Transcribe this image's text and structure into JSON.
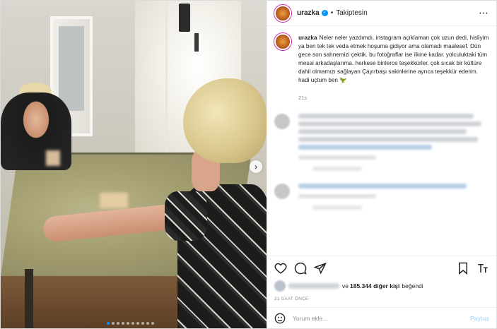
{
  "post": {
    "username": "urazka",
    "follow_status": "Takiptesin",
    "more_icon": "more-horizontal-icon"
  },
  "caption": {
    "username": "urazka",
    "text": "Neler neler yazdımdı. instagram açıklaman çok uzun dedi, hisliyim ya ben tek tek veda etmek hoşuma gidiyor ama olamadı maalesef. Dün gece son sahnemizi çektik. bu fotoğraflar ise ilkine kadar. yolculuktaki tüm mesai arkadaşlarıma. herkese binlerce teşekkürler. çok sıcak bir kültüre dahil olmamızı sağlayan Çayırbaşı sakinlerine ayrıca teşekkür ederim. hadi uçtum ben",
    "time": "21s"
  },
  "likes": {
    "suffix": "ve",
    "count": "185.344 diğer kişi",
    "end": "beğendi"
  },
  "posted_ago": "21 SAAT ÖNCE",
  "comment_box": {
    "placeholder": "Yorum ekle...",
    "submit_label": "Paylaş"
  },
  "colors": {
    "accent": "#0095f6",
    "submit_disabled": "#b2dffc",
    "muted": "#8e8e8e"
  }
}
